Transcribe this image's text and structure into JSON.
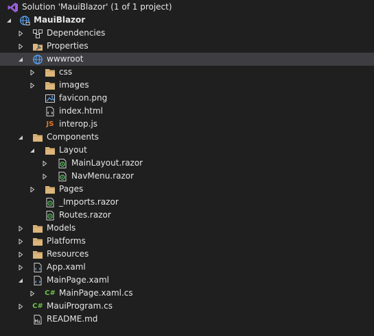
{
  "solution": {
    "label": "Solution 'MauiBlazor' (1 of 1 project)",
    "icon": "visual-studio-solution-icon"
  },
  "project": {
    "label": "MauiBlazor",
    "icon": "globe-project-icon"
  },
  "dependencies": {
    "label": "Dependencies",
    "icon": "dependencies-icon"
  },
  "properties": {
    "label": "Properties",
    "icon": "wrench-properties-icon"
  },
  "wwwroot": {
    "label": "wwwroot",
    "icon": "globe-icon",
    "css": {
      "label": "css"
    },
    "images": {
      "label": "images"
    },
    "favicon": {
      "label": "favicon.png",
      "icon": "image-file-icon"
    },
    "index": {
      "label": "index.html",
      "icon": "html-file-icon"
    },
    "interop": {
      "label": "interop.js",
      "icon": "js-file-icon",
      "glyph": "JS"
    }
  },
  "components": {
    "label": "Components",
    "layout": {
      "label": "Layout",
      "main_layout": {
        "label": "MainLayout.razor",
        "icon": "razor-file-icon"
      },
      "nav_menu": {
        "label": "NavMenu.razor",
        "icon": "razor-file-icon"
      }
    },
    "pages": {
      "label": "Pages"
    },
    "imports": {
      "label": "_Imports.razor",
      "icon": "razor-file-icon"
    },
    "routes": {
      "label": "Routes.razor",
      "icon": "razor-file-icon"
    }
  },
  "models": {
    "label": "Models"
  },
  "platforms": {
    "label": "Platforms"
  },
  "resources": {
    "label": "Resources"
  },
  "app_xaml": {
    "label": "App.xaml",
    "icon": "xaml-file-icon"
  },
  "main_page": {
    "label": "MainPage.xaml",
    "icon": "xaml-file-icon",
    "code_behind": {
      "label": "MainPage.xaml.cs",
      "icon": "csharp-file-icon",
      "glyph": "C#"
    }
  },
  "maui_program": {
    "label": "MauiProgram.cs",
    "icon": "csharp-file-icon",
    "glyph": "C#"
  },
  "readme": {
    "label": "README.md",
    "icon": "markdown-file-icon"
  },
  "colors": {
    "background": "#1f1f1f",
    "selected": "#3e3e42",
    "folder": "#dcb67a",
    "globe": "#5aa2f2",
    "razor_green": "#58b05d",
    "csharp_green": "#6cc24a",
    "js_orange": "#e0792b"
  }
}
